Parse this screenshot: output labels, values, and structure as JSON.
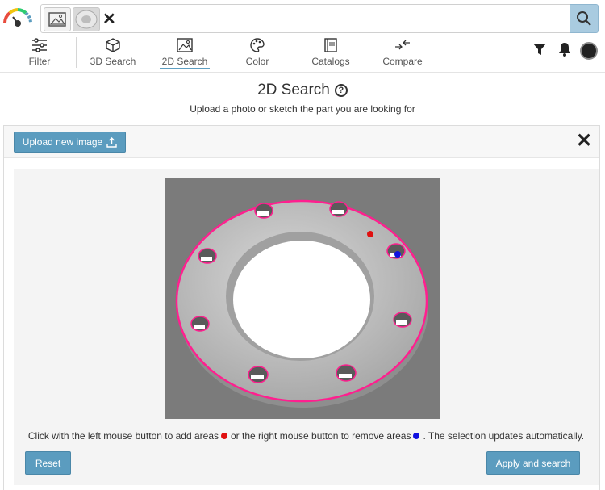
{
  "colors": {
    "accent": "#5b9cbf",
    "search_button_bg": "#a9cbe0",
    "selection_outline": "#ff1f8f",
    "add_marker": "#e01010",
    "remove_marker": "#1010e0"
  },
  "search": {
    "thumbnails": [
      "image-placeholder-icon",
      "flange-thumbnail"
    ],
    "remove_icon": "close-icon",
    "button_icon": "search-icon"
  },
  "nav": {
    "items": [
      {
        "label": "Filter",
        "icon": "sliders-icon"
      },
      {
        "label": "3D Search",
        "icon": "cube-icon"
      },
      {
        "label": "2D Search",
        "icon": "image-icon",
        "active": true
      },
      {
        "label": "Color",
        "icon": "palette-icon"
      },
      {
        "label": "Catalogs",
        "icon": "catalog-icon"
      },
      {
        "label": "Compare",
        "icon": "compare-arrows-icon"
      }
    ],
    "right_icons": [
      "filter-funnel-icon",
      "bell-icon",
      "user-avatar"
    ]
  },
  "page": {
    "title": "2D Search",
    "subtitle": "Upload a photo or sketch the part you are looking for"
  },
  "panel": {
    "upload_label": "Upload new image",
    "instruction_part1": "Click with the left mouse button to add areas",
    "instruction_part2": "or the right mouse button to remove areas",
    "instruction_part3": ". The selection updates automatically.",
    "reset_label": "Reset",
    "apply_label": "Apply and search"
  }
}
